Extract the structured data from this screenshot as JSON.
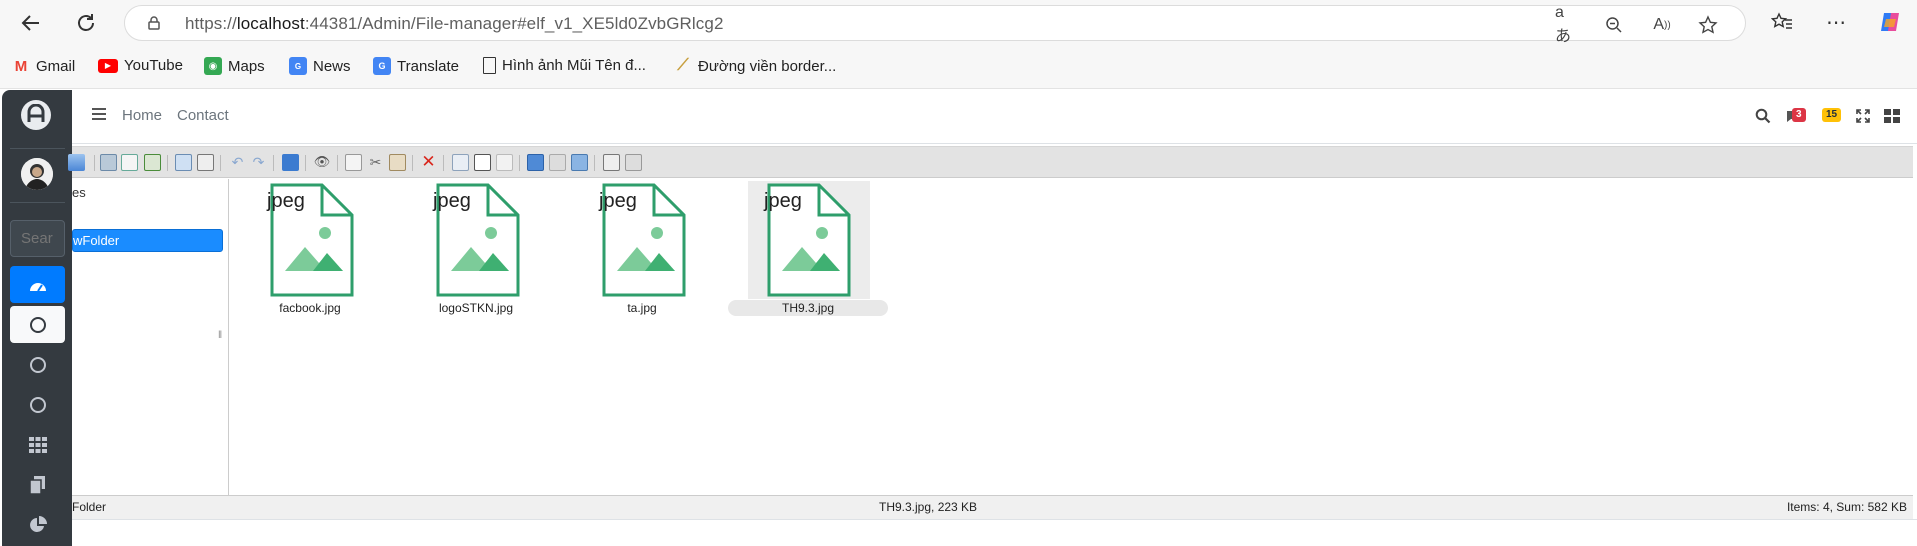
{
  "browser": {
    "url_prefix": "https://",
    "url_host": "localhost",
    "url_rest": ":44381/Admin/File-manager#elf_v1_XE5ld0ZvbGRlcg2"
  },
  "bookmarks": [
    {
      "label": "Gmail",
      "icon": "gmail-icon"
    },
    {
      "label": "YouTube",
      "icon": "youtube-icon"
    },
    {
      "label": "Maps",
      "icon": "maps-icon"
    },
    {
      "label": "News",
      "icon": "news-icon"
    },
    {
      "label": "Translate",
      "icon": "translate-icon"
    },
    {
      "label": "Hình ảnh Mũi Tên đ...",
      "icon": "page-icon"
    },
    {
      "label": "Đường viền border...",
      "icon": "bookmark-image-icon"
    }
  ],
  "header": {
    "nav": [
      "Home",
      "Contact"
    ],
    "messages_count": "3",
    "notifications_count": "15"
  },
  "sidebar": {
    "search_placeholder": "Sear"
  },
  "elfinder": {
    "nav_root_label": "es",
    "nav_folder_label": "wFolder",
    "files": [
      {
        "name": "facbook.jpg",
        "type": "jpeg"
      },
      {
        "name": "logoSTKN.jpg",
        "type": "jpeg"
      },
      {
        "name": "ta.jpg",
        "type": "jpeg"
      },
      {
        "name": "TH9.3.jpg",
        "type": "jpeg"
      }
    ],
    "status_left": "Folder",
    "status_center": "TH9.3.jpg, 223 KB",
    "status_right": "Items: 4, Sum: 582 KB"
  },
  "colors": {
    "accent": "#007bff",
    "file_icon_green": "#2e9e6b",
    "sidebar_bg": "#343a40"
  }
}
